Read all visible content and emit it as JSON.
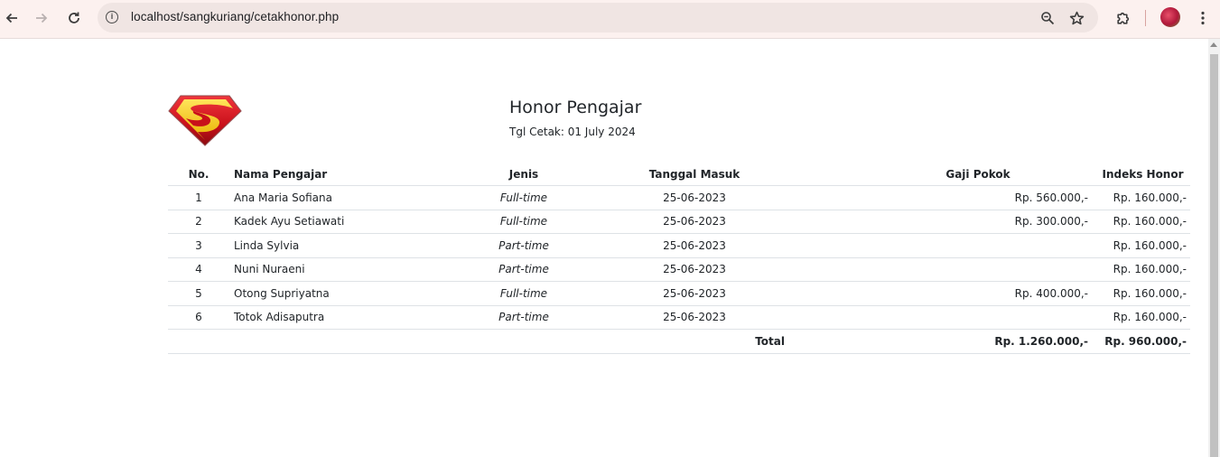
{
  "browser": {
    "url": "localhost/sangkuriang/cetakhonor.php"
  },
  "report": {
    "title": "Honor Pengajar",
    "print_date": "Tgl Cetak: 01 July 2024"
  },
  "table": {
    "headers": [
      "No.",
      "Nama Pengajar",
      "Jenis",
      "Tanggal Masuk",
      "Gaji Pokok",
      "Indeks Honor"
    ],
    "rows": [
      {
        "no": "1",
        "nama": "Ana Maria Sofiana",
        "jenis": "Full-time",
        "tanggal": "25-06-2023",
        "gaji": "Rp. 560.000,-",
        "indeks": "Rp. 160.000,-"
      },
      {
        "no": "2",
        "nama": "Kadek Ayu Setiawati",
        "jenis": "Full-time",
        "tanggal": "25-06-2023",
        "gaji": "Rp. 300.000,-",
        "indeks": "Rp. 160.000,-"
      },
      {
        "no": "3",
        "nama": "Linda Sylvia",
        "jenis": "Part-time",
        "tanggal": "25-06-2023",
        "gaji": "",
        "indeks": "Rp. 160.000,-"
      },
      {
        "no": "4",
        "nama": "Nuni Nuraeni",
        "jenis": "Part-time",
        "tanggal": "25-06-2023",
        "gaji": "",
        "indeks": "Rp. 160.000,-"
      },
      {
        "no": "5",
        "nama": "Otong Supriyatna",
        "jenis": "Full-time",
        "tanggal": "25-06-2023",
        "gaji": "Rp. 400.000,-",
        "indeks": "Rp. 160.000,-"
      },
      {
        "no": "6",
        "nama": "Totok Adisaputra",
        "jenis": "Part-time",
        "tanggal": "25-06-2023",
        "gaji": "",
        "indeks": "Rp. 160.000,-"
      }
    ],
    "total": {
      "label": "Total",
      "gaji": "Rp. 1.260.000,-",
      "indeks": "Rp. 960.000,-"
    }
  },
  "icons": {
    "back": "arrow-left-icon",
    "forward": "arrow-right-icon",
    "reload": "reload-icon",
    "site_info": "info-icon",
    "zoom": "zoom-icon",
    "bookmark": "star-icon",
    "extensions": "puzzle-icon",
    "menu": "kebab-menu-icon",
    "logo": "superman-logo"
  },
  "colors": {
    "chrome_bg": "#fcf1ef",
    "omnibox_bg": "#f0e5e3",
    "logo_red": "#d3141c",
    "logo_yellow": "#f7d117"
  }
}
